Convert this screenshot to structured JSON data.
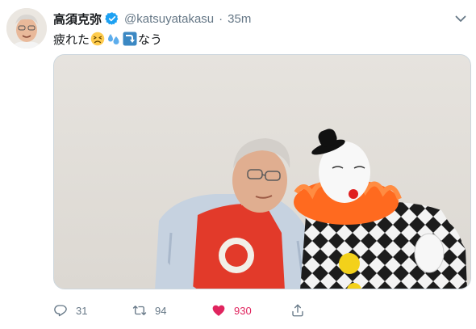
{
  "tweet": {
    "display_name": "高須克弥",
    "handle": "@katsuyatakasu",
    "separator": "·",
    "time": "35m",
    "text_prefix": "疲れた",
    "text_suffix": "なう",
    "emojis": [
      "tired-face-emoji",
      "sweat-droplets-emoji",
      "right-arrow-curving-down-emoji"
    ]
  },
  "actions": {
    "reply_count": "31",
    "retweet_count": "94",
    "like_count": "930"
  },
  "colors": {
    "like": "#e0245e",
    "verified": "#1da1f2",
    "meta_text": "#657786"
  },
  "icons": {
    "reply": "reply-icon",
    "retweet": "retweet-icon",
    "like": "heart-icon",
    "share": "share-icon",
    "menu": "chevron-down-icon",
    "verified": "verified-badge-icon"
  }
}
